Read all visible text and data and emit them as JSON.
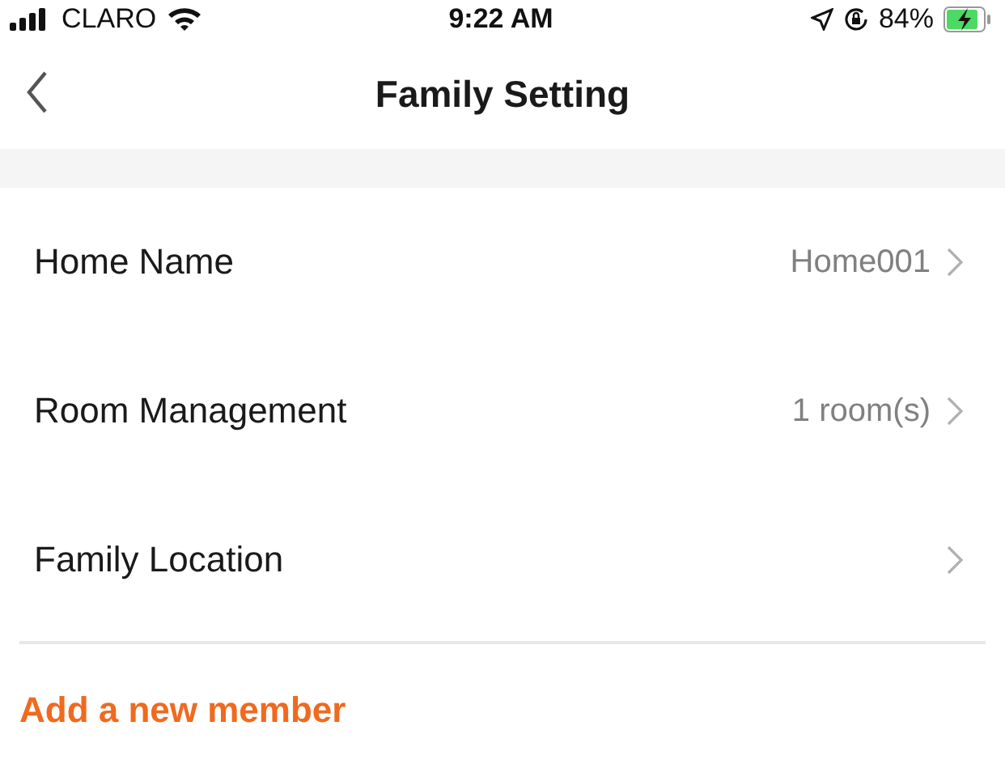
{
  "status_bar": {
    "carrier": "CLARO",
    "time": "9:22 AM",
    "battery": "84%"
  },
  "nav": {
    "title": "Family Setting"
  },
  "settings": [
    {
      "label": "Home Name",
      "value": "Home001"
    },
    {
      "label": "Room Management",
      "value": "1 room(s)"
    },
    {
      "label": "Family Location"
    }
  ],
  "add_member": "Add a new member"
}
